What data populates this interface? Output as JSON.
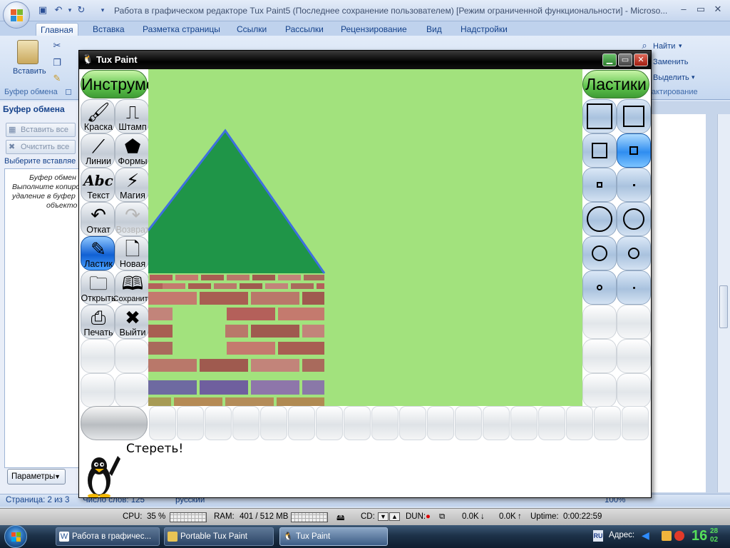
{
  "word": {
    "title": "Работа в графическом редакторе Tux Paint5 (Последнее сохранение пользователем) [Режим ограниченной функциональности] - Microso...",
    "tabs": [
      "Главная",
      "Вставка",
      "Разметка страницы",
      "Ссылки",
      "Рассылки",
      "Рецензирование",
      "Вид",
      "Надстройки"
    ],
    "active_tab": "Главная",
    "ribbon": {
      "paste_label": "Вставить",
      "clipboard_group": "Буфер обмена",
      "find_label": "Найти",
      "replace_label": "Заменить",
      "select_label": "Выделить",
      "editing_group": "актирование"
    },
    "clipboard_pane": {
      "title": "Буфер обмена",
      "paste_all": "Вставить все",
      "clear_all": "Очистить все",
      "hint": "Выберите вставляе",
      "empty_lines": [
        "Буфер обмен",
        "Выполните копиро",
        "удаление в буфер",
        "объекто"
      ],
      "params_button": "Параметры"
    },
    "status": {
      "page": "Страница: 2 из 3",
      "words": "Число слов: 125",
      "language": "русский",
      "zoom": "100%"
    }
  },
  "meter": {
    "cpu_label": "CPU:",
    "cpu_value": "35 %",
    "ram_label": "RAM:",
    "ram_value": "401 / 512 MB",
    "cd_label": "CD:",
    "dun_label": "DUN:",
    "down": "0.0K",
    "up": "0.0K",
    "uptime_label": "Uptime:",
    "uptime_value": "0:00:22:59"
  },
  "taskbar": {
    "buttons": [
      "Работа в графичес...",
      "Portable Tux Paint",
      "Tux Paint"
    ],
    "active_index": 2,
    "address_label": "Адрес:",
    "clock_hour": "16",
    "clock_min": "28",
    "clock_date": "02"
  },
  "tuxpaint": {
    "title": "Tux Paint",
    "tools_header": "Инструменты",
    "erasers_header": "Ластики",
    "tools": [
      {
        "label": "Краска",
        "icon": "paintbrush-icon",
        "glyph": "🖌",
        "state": "normal"
      },
      {
        "label": "Штамп",
        "icon": "stamp-icon",
        "glyph": "⎍",
        "state": "normal"
      },
      {
        "label": "Линии",
        "icon": "lines-icon",
        "glyph": "⟋",
        "state": "normal"
      },
      {
        "label": "Формы",
        "icon": "shapes-icon",
        "glyph": "⬟",
        "state": "normal"
      },
      {
        "label": "Текст",
        "icon": "text-icon",
        "glyph": "Abc",
        "state": "normal"
      },
      {
        "label": "Магия",
        "icon": "magic-wand-icon",
        "glyph": "⚡",
        "state": "normal"
      },
      {
        "label": "Откат",
        "icon": "undo-icon",
        "glyph": "↶",
        "state": "normal"
      },
      {
        "label": "Возврат",
        "icon": "redo-icon",
        "glyph": "↷",
        "state": "disabled"
      },
      {
        "label": "Ластик",
        "icon": "eraser-icon",
        "glyph": "✎",
        "state": "active"
      },
      {
        "label": "Новая",
        "icon": "new-page-icon",
        "glyph": "🗋",
        "state": "normal"
      },
      {
        "label": "Открыть",
        "icon": "open-icon",
        "glyph": "🗀",
        "state": "normal"
      },
      {
        "label": "Сохранить",
        "icon": "save-icon",
        "glyph": "🕮",
        "state": "normal"
      },
      {
        "label": "Печать",
        "icon": "printer-icon",
        "glyph": "⎙",
        "state": "normal"
      },
      {
        "label": "Выйти",
        "icon": "quit-icon",
        "glyph": "✖",
        "state": "normal"
      }
    ],
    "info_text": "Стереть!",
    "colors": {
      "canvas_bg": "#a2e27d",
      "roof": "#1f9548",
      "roof_edge": "#3e6fe0",
      "active_tool": "#1161d4"
    }
  }
}
